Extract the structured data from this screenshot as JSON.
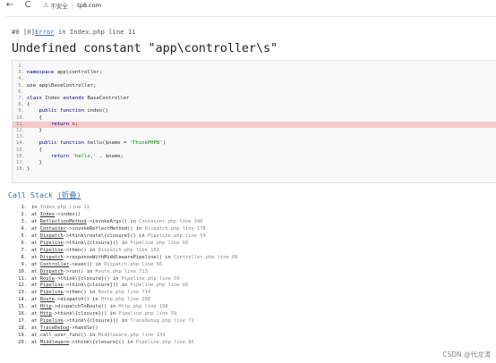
{
  "browser": {
    "back_glyph": "←",
    "reload_glyph": "C",
    "security_label": "不安全",
    "url": "tp8.com"
  },
  "error": {
    "prefix": "#0 [0]",
    "type": "Error",
    "location": "in Index.php line 11",
    "message": "Undefined constant \"app\\controller\\s\""
  },
  "source_lines": [
    {
      "n": "2.",
      "text": "",
      "hl": false
    },
    {
      "n": "3.",
      "text": "namespace app\\controller;",
      "hl": false
    },
    {
      "n": "4.",
      "text": "",
      "hl": false
    },
    {
      "n": "5.",
      "text": "use app\\BaseController;",
      "hl": false
    },
    {
      "n": "6.",
      "text": "",
      "hl": false
    },
    {
      "n": "7.",
      "text": "class Index extends BaseController",
      "hl": false
    },
    {
      "n": "8.",
      "text": "{",
      "hl": false
    },
    {
      "n": "9.",
      "text": "    public function index()",
      "hl": false
    },
    {
      "n": "10.",
      "text": "    {",
      "hl": false
    },
    {
      "n": "11.",
      "text": "        return s;",
      "hl": true
    },
    {
      "n": "12.",
      "text": "    }",
      "hl": false
    },
    {
      "n": "13.",
      "text": "",
      "hl": false
    },
    {
      "n": "14.",
      "text": "    public function hello($name = 'ThinkPHP8')",
      "hl": false
    },
    {
      "n": "15.",
      "text": "    {",
      "hl": false
    },
    {
      "n": "16.",
      "text": "        return 'hello,' . $name;",
      "hl": false
    },
    {
      "n": "17.",
      "text": "    }",
      "hl": false
    },
    {
      "n": "18.",
      "text": "}",
      "hl": false
    }
  ],
  "call_stack": {
    "title": "Call Stack",
    "fold_label": "(折叠)",
    "rows": [
      {
        "n": "1.",
        "pre": "in ",
        "cls": "",
        "mid": "",
        "file": "Index.php line 11"
      },
      {
        "n": "2.",
        "pre": "at ",
        "cls": "Index",
        "mid": "->index()",
        "file": ""
      },
      {
        "n": "3.",
        "pre": "at ",
        "cls": "ReflectionMethod",
        "mid": "->invokeArgs() in ",
        "file": "Container.php line 348"
      },
      {
        "n": "4.",
        "pre": "at ",
        "cls": "Container",
        "mid": "->invokeReflectMethod() in ",
        "file": "Dispatch.php line 178"
      },
      {
        "n": "5.",
        "pre": "at ",
        "cls": "Dispatch",
        "mid": "->think\\route\\{closure}() in ",
        "file": "Pipeline.php line 59"
      },
      {
        "n": "6.",
        "pre": "at ",
        "cls": "Pipeline",
        "mid": "->think\\{closure}() in ",
        "file": "Pipeline.php line 66"
      },
      {
        "n": "7.",
        "pre": "at ",
        "cls": "Pipeline",
        "mid": "->then() in ",
        "file": "Dispatch.php line 181"
      },
      {
        "n": "8.",
        "pre": "at ",
        "cls": "Dispatch",
        "mid": "->responseWithMiddlewarePipeline() in ",
        "file": "Controller.php line 88"
      },
      {
        "n": "9.",
        "pre": "at ",
        "cls": "Controller",
        "mid": "->exec() in ",
        "file": "Dispatch.php line 56"
      },
      {
        "n": "10.",
        "pre": "at ",
        "cls": "Dispatch",
        "mid": "->run() in ",
        "file": "Route.php line 713"
      },
      {
        "n": "11.",
        "pre": "at ",
        "cls": "Route",
        "mid": "->think\\{closure}() in ",
        "file": "Pipeline.php line 59"
      },
      {
        "n": "12.",
        "pre": "at ",
        "cls": "Pipeline",
        "mid": "->think\\{closure}() in ",
        "file": "Pipeline.php line 66"
      },
      {
        "n": "13.",
        "pre": "at ",
        "cls": "Pipeline",
        "mid": "->then() in ",
        "file": "Route.php line 714"
      },
      {
        "n": "14.",
        "pre": "at ",
        "cls": "Route",
        "mid": "->dispatch() in ",
        "file": "Http.php line 208"
      },
      {
        "n": "15.",
        "pre": "at ",
        "cls": "Http",
        "mid": "->dispatchToRoute() in ",
        "file": "Http.php line 198"
      },
      {
        "n": "16.",
        "pre": "at ",
        "cls": "Http",
        "mid": "->think\\{closure}() in ",
        "file": "Pipeline.php line 59"
      },
      {
        "n": "17.",
        "pre": "at ",
        "cls": "Pipeline",
        "mid": "->think\\{closure}() in ",
        "file": "TraceDebug.php line 71"
      },
      {
        "n": "18.",
        "pre": "at ",
        "cls": "TraceDebug",
        "mid": "->handle()",
        "file": ""
      },
      {
        "n": "19.",
        "pre": "at ",
        "cls": "",
        "mid": "call_user_func() in ",
        "file": "Middleware.php line 134"
      },
      {
        "n": "20.",
        "pre": "at ",
        "cls": "Middleware",
        "mid": "->think\\{closure}() in ",
        "file": "Pipeline.php line 85"
      }
    ]
  },
  "watermark": "CSDN @代龙涛"
}
